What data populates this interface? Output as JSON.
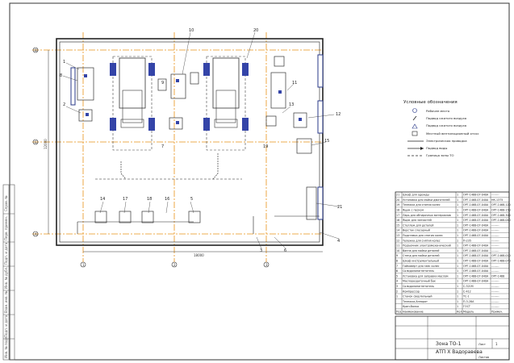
{
  "sheet": {
    "margin_strip": [
      "Инв. № подл.",
      "Подп. и дата",
      "Взам. инв. №",
      "Инв. № дубл.",
      "Подп. и дата",
      "Перв. примен.",
      "Справ. №"
    ]
  },
  "plan": {
    "grid_axes": [
      "1",
      "2",
      "3",
      "4",
      "А",
      "Б",
      "В"
    ],
    "dimensions": {
      "bottom": "18000",
      "left": "12000"
    },
    "callouts": [
      "1",
      "2",
      "3",
      "4",
      "5",
      "6",
      "7",
      "8",
      "9",
      "10",
      "11",
      "12",
      "13",
      "14",
      "15",
      "16",
      "17",
      "18",
      "19",
      "20",
      "21"
    ]
  },
  "legend": {
    "title": "Условные обозначения",
    "items": [
      {
        "symbol": "circle",
        "label": "Рабочее место"
      },
      {
        "symbol": "slash",
        "label": "Подвод сжатого воздуха"
      },
      {
        "symbol": "triangle",
        "label": "Подвод сжатого воздуха"
      },
      {
        "symbol": "square",
        "label": "Местный вентиляционный отсос"
      },
      {
        "symbol": "line",
        "label": "Электрическая проводка"
      },
      {
        "symbol": "arrow",
        "label": "Подвод воды"
      },
      {
        "symbol": "dash",
        "label": "Граница зоны ТО"
      }
    ]
  },
  "spec_table": {
    "headers": [
      "Поз.",
      "Наименование",
      "Кол.",
      "Модель",
      "Примеч."
    ],
    "rows": [
      {
        "pos": "21",
        "name": "Шкаф для одежды",
        "qty": "1",
        "model": "ОРГ-1468-07-040А",
        "note": "--------"
      },
      {
        "pos": "20",
        "name": "Установка для мойки двигателей",
        "qty": "1",
        "model": "ОРГ-1468-07-040А",
        "note": "НК-1375"
      },
      {
        "pos": "19",
        "name": "Тележка для снятия колес",
        "qty": "1",
        "model": "ОРГ-1468-07-040А",
        "note": "ОРГ-1468-120"
      },
      {
        "pos": "18",
        "name": "Ящик с песком",
        "qty": "1",
        "model": "ОРГ-1468-07-040А",
        "note": "ОРГ-1468-150"
      },
      {
        "pos": "17",
        "name": "Ларь для обтирочных материалов",
        "qty": "1",
        "model": "ОРГ-1468-07-040А",
        "note": "ОРГ-1468-300"
      },
      {
        "pos": "16",
        "name": "Ящик для запчастей",
        "qty": "1",
        "model": "ОРГ-1468-07-040А",
        "note": "ОРГ-1468-040"
      },
      {
        "pos": "15",
        "name": "Стеллаж для деталей",
        "qty": "1",
        "model": "ОРГ-1468-07-040А",
        "note": "--------"
      },
      {
        "pos": "14",
        "name": "Верстак слесарный",
        "qty": "1",
        "model": "ОРГ-1468-07-040А",
        "note": "--------"
      },
      {
        "pos": "13",
        "name": "Подставка для снятия колес",
        "qty": "1",
        "model": "ОРГ-1468-07-040А",
        "note": "--------"
      },
      {
        "pos": "12",
        "name": "Тележка для снятия колес",
        "qty": "1",
        "model": "П-235",
        "note": "--------"
      },
      {
        "pos": "11",
        "name": "Подъемник электромеханический",
        "qty": "1",
        "model": "ОРГ-1468-07-040А",
        "note": "--------"
      },
      {
        "pos": "10",
        "name": "Ванна для мойки деталей",
        "qty": "1",
        "model": "ОРГ-1468-07-040А",
        "note": "--------"
      },
      {
        "pos": "9",
        "name": "Стенд для мойки деталей",
        "qty": "1",
        "model": "ОРГ-1468-07-040А",
        "note": "ОРГ-1468-010"
      },
      {
        "pos": "8",
        "name": "Шкаф инструментальный",
        "qty": "1",
        "model": "ОРГ-1468-07-040А",
        "note": "ОРГ-1468-070"
      },
      {
        "pos": "7",
        "name": "Гайковерт для гаек колес",
        "qty": "1",
        "model": "ОРГ-1468-07-040А",
        "note": "--------"
      },
      {
        "pos": "6",
        "name": "Солидолонагнетатель",
        "qty": "1",
        "model": "ОРГ-1468-07-040А",
        "note": "--------"
      },
      {
        "pos": "5",
        "name": "Установка для заправки маслом",
        "qty": "1",
        "model": "ОРГ-1468-07-040А",
        "note": "ОРГ-1468"
      },
      {
        "pos": "4",
        "name": "Маслораздаточный бак",
        "qty": "1",
        "model": "ОРГ-1468-07-040А",
        "note": "--------"
      },
      {
        "pos": "3",
        "name": "Солидолонагнетатель",
        "qty": "1",
        "model": "С-321М",
        "note": "--------"
      },
      {
        "pos": "2",
        "name": "Компрессор",
        "qty": "1",
        "model": "С-412",
        "note": "--------"
      },
      {
        "pos": "1",
        "name": "Станок сверлильный",
        "qty": "1",
        "model": "ТС-1",
        "note": "--------"
      },
      {
        "pos": "",
        "name": "Тележка-Аппарат",
        "qty": "1",
        "model": "П-3-28А",
        "note": "--------"
      },
      {
        "pos": "",
        "name": "Кран-балка",
        "qty": "1",
        "model": "ГОСТ",
        "note": "--------"
      }
    ]
  },
  "title_block": {
    "title_line1": "Зона ТО-1",
    "title_line2": "АТП Х Вадоравева",
    "sheet_label": "Лист",
    "sheet_no": "1",
    "sheets_label": "Листов"
  }
}
